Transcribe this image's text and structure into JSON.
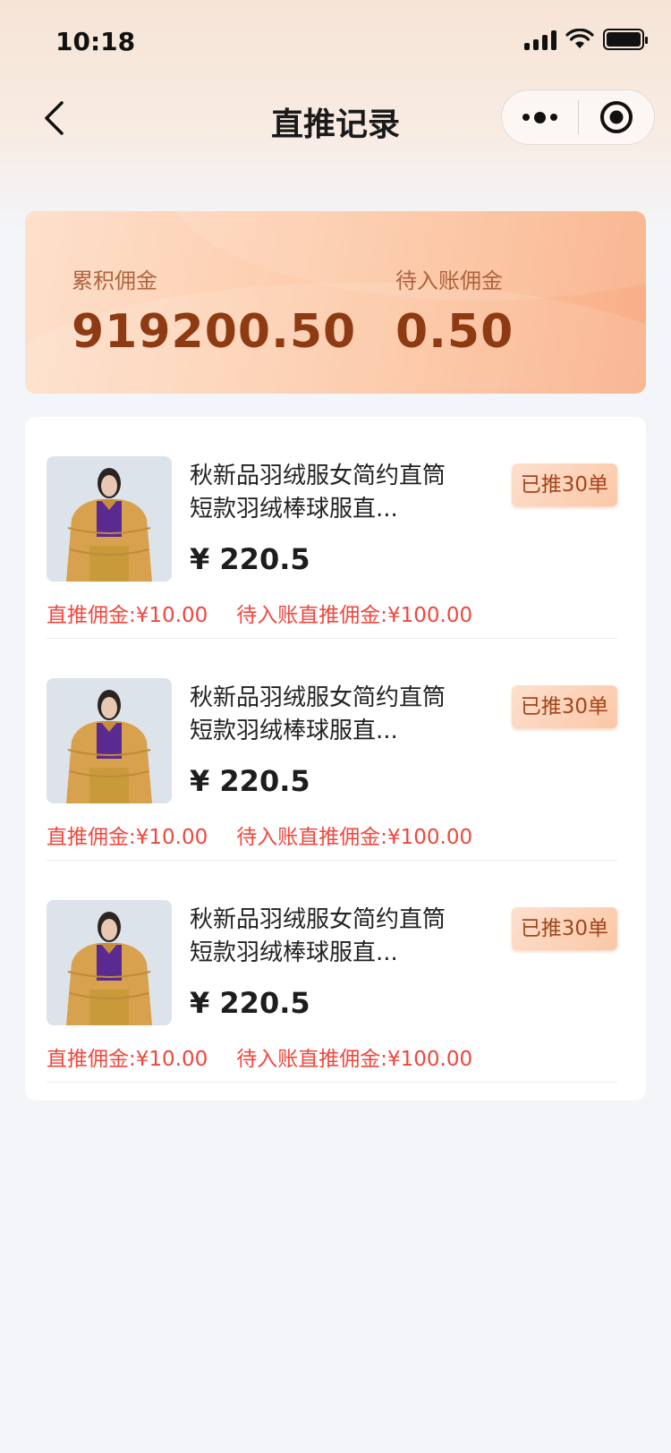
{
  "status_bar": {
    "time": "10:18"
  },
  "nav": {
    "title": "直推记录",
    "icons": [
      "chevron-left-icon",
      "more-dots-icon",
      "target-icon"
    ]
  },
  "summary": {
    "total_label": "累积佣金",
    "total_value": "919200.50",
    "pending_label": "待入账佣金",
    "pending_value": "0.50"
  },
  "records": [
    {
      "title": "秋新品羽绒服女简约直筒短款羽绒棒球服直...",
      "price": "¥ 220.5",
      "badge": "已推30单",
      "direct_commission": "直推佣金:¥10.00",
      "pending_commission": "待入账直推佣金:¥100.00"
    },
    {
      "title": "秋新品羽绒服女简约直筒短款羽绒棒球服直...",
      "price": "¥ 220.5",
      "badge": "已推30单",
      "direct_commission": "直推佣金:¥10.00",
      "pending_commission": "待入账直推佣金:¥100.00"
    },
    {
      "title": "秋新品羽绒服女简约直筒短款羽绒棒球服直...",
      "price": "¥ 220.5",
      "badge": "已推30单",
      "direct_commission": "直推佣金:¥10.00",
      "pending_commission": "待入账直推佣金:¥100.00"
    }
  ],
  "colors": {
    "accent_dark": "#8e3b14",
    "badge_text": "#a3461c",
    "commission_red": "#f0473d",
    "page_background": "#f3f5f9"
  }
}
